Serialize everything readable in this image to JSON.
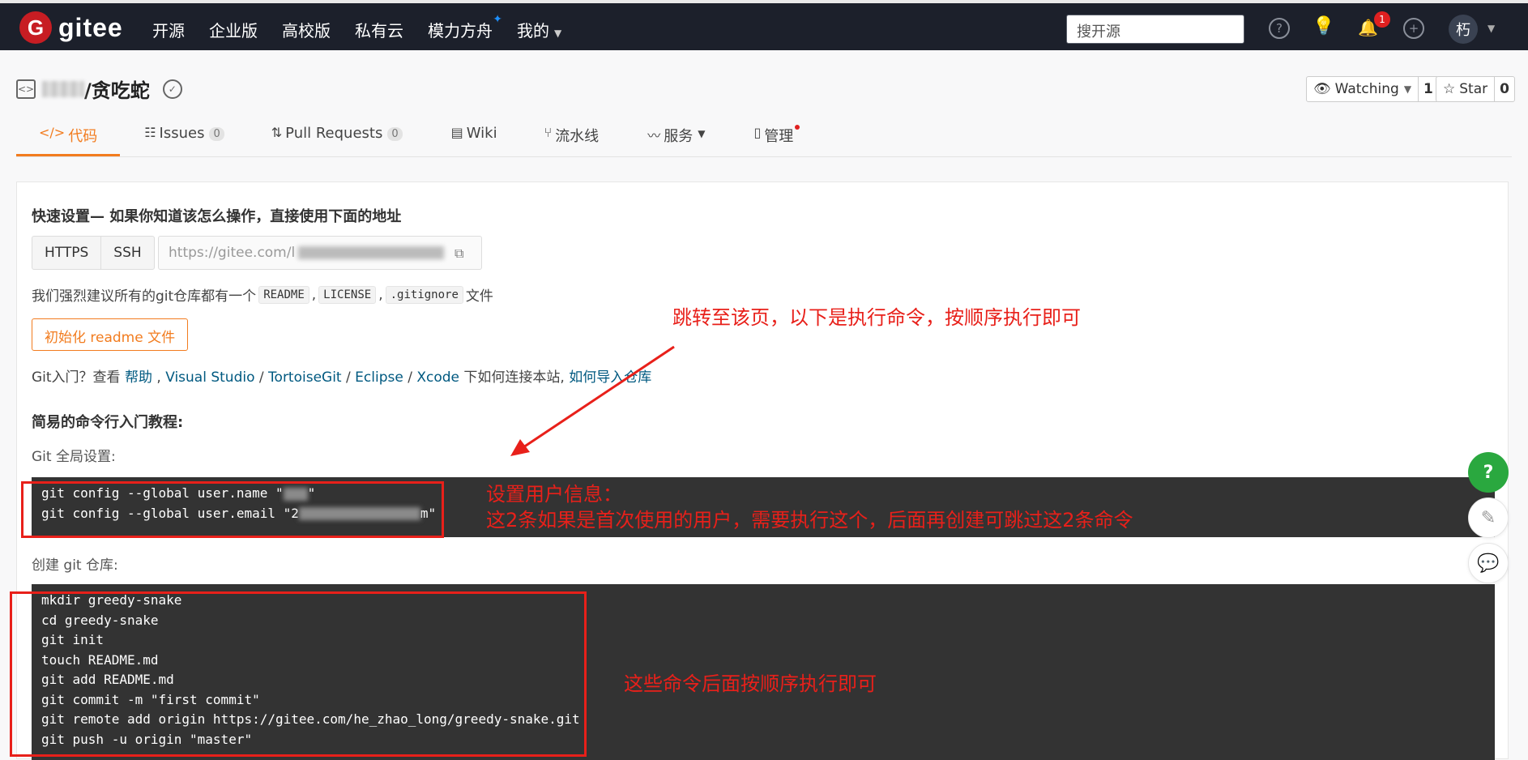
{
  "topbar": {
    "logo_letter": "G",
    "logo_text": "gitee",
    "nav": [
      "开源",
      "企业版",
      "高校版",
      "私有云",
      "模力方舟",
      "我的"
    ],
    "search_placeholder": "搜开源",
    "help_icon": "?",
    "plus_icon": "+",
    "notification_count": "1",
    "avatar": "朽"
  },
  "repo": {
    "name": "/贪吃蛇",
    "watch_label": "Watching",
    "watch_count": "1",
    "star_label": "Star",
    "star_count": "0"
  },
  "tabs": [
    {
      "label": "代码",
      "count": ""
    },
    {
      "label": "Issues",
      "count": "0"
    },
    {
      "label": "Pull Requests",
      "count": "0"
    },
    {
      "label": "Wiki",
      "count": ""
    },
    {
      "label": "流水线",
      "count": ""
    },
    {
      "label": "服务",
      "count": ""
    },
    {
      "label": "管理",
      "count": ""
    }
  ],
  "quick_setup": {
    "title": "快速设置— 如果你知道该怎么操作，直接使用下面的地址",
    "https": "HTTPS",
    "ssh": "SSH",
    "url": "https://gitee.com/l",
    "recommend_prefix": "我们强烈建议所有的git仓库都有一个",
    "recommend_files": [
      "README",
      "LICENSE",
      ".gitignore"
    ],
    "recommend_suffix": "文件",
    "init_button": "初始化 readme 文件",
    "help_prefix": "Git入门？查看",
    "help_link": "帮助",
    "ide_links": [
      "Visual Studio",
      "TortoiseGit",
      "Eclipse",
      "Xcode"
    ],
    "help_middle": "下如何连接本站,",
    "import_link": "如何导入仓库"
  },
  "tutorial": {
    "title": "简易的命令行入门教程:",
    "global_label": "Git 全局设置:",
    "global_cmds": [
      "git config --global user.name \"",
      "git config --global user.email \"2"
    ],
    "create_label": "创建 git 仓库:",
    "create_cmds": [
      "mkdir greedy-snake",
      "cd greedy-snake",
      "git init",
      "touch README.md",
      "git add README.md",
      "git commit -m \"first commit\"",
      "git remote add origin https://gitee.com/he_zhao_long/greedy-snake.git",
      "git push -u origin \"master\""
    ]
  },
  "annotations": {
    "note1": "跳转至该页，以下是执行命令，按顺序执行即可",
    "note2_line1": "设置用户信息：",
    "note2_line2": "这2条如果是首次使用的用户，需要执行这个，后面再创建可跳过这2条命令",
    "note3": "这些命令后面按顺序执行即可",
    "color": "#e8201a"
  },
  "float": {
    "help": "?"
  }
}
